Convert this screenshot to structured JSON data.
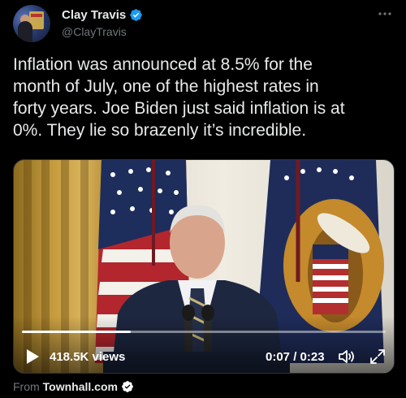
{
  "author": {
    "display_name": "Clay Travis",
    "handle": "@ClayTravis",
    "verified_icon": "verified-badge-icon",
    "avatar_icon": "avatar"
  },
  "more_icon": "more-options-icon",
  "tweet": {
    "text": "Inflation was announced at 8.5% for the\nmonth of July, one of the highest rates in\nforty years. Joe Biden just said inflation is at\n0%. They lie so brazenly it’s incredible."
  },
  "video": {
    "views": "418.5K views",
    "time": "0:07 / 0:23",
    "progress_fraction": 0.3,
    "play_icon": "play-icon",
    "volume_icon": "volume-icon",
    "fullscreen_icon": "fullscreen-icon"
  },
  "source": {
    "prefix": "From",
    "name": "Townhall.com",
    "verified_icon": "verified-badge-icon"
  },
  "colors": {
    "background": "#000000",
    "text_primary": "#e7e9ea",
    "text_secondary": "#71767b",
    "verified_blue": "#1d9bf0"
  }
}
